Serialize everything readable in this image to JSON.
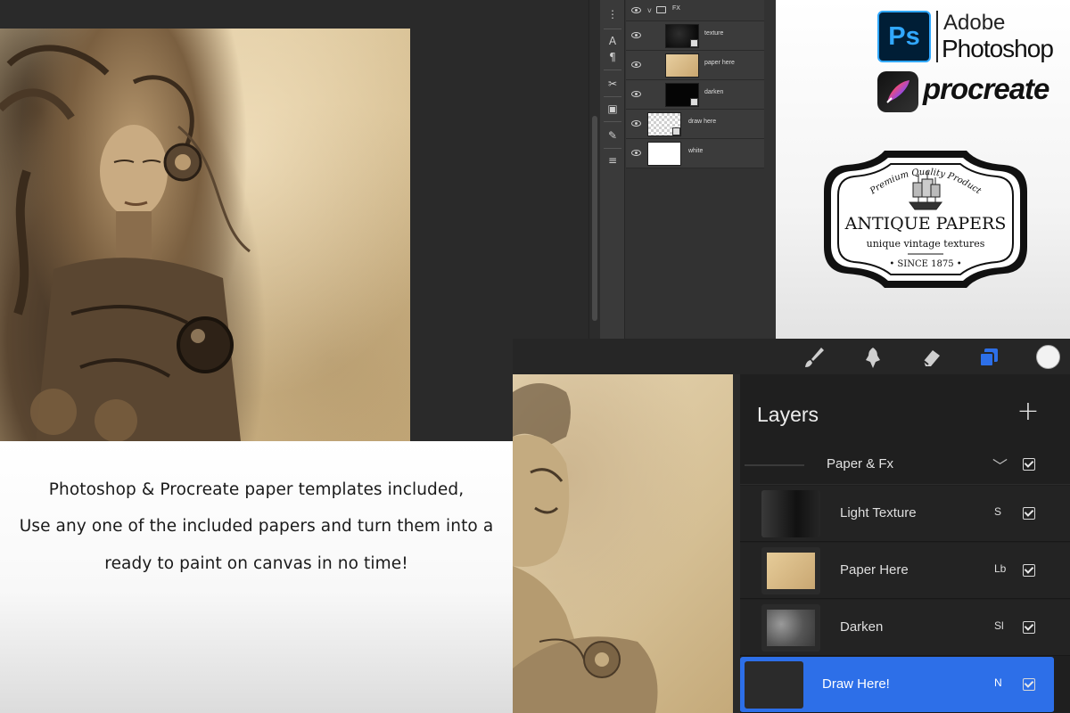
{
  "photoshop_panel": {
    "group": {
      "name": "FX"
    },
    "layers": [
      {
        "name": "texture",
        "thumb": "black-texture",
        "in_group": true
      },
      {
        "name": "paper here",
        "thumb": "paper",
        "in_group": true
      },
      {
        "name": "darken",
        "thumb": "black",
        "in_group": true
      },
      {
        "name": "draw here",
        "thumb": "sketch",
        "in_group": false
      },
      {
        "name": "white",
        "thumb": "white",
        "in_group": false
      }
    ]
  },
  "branding": {
    "photoshop_logo": {
      "letters": "Ps",
      "line1": "Adobe",
      "line2": "Photoshop"
    },
    "procreate_logo": {
      "word": "procreate"
    },
    "badge": {
      "top_arc": "Premium Quality Product",
      "title": "ANTIQUE PAPERS",
      "subtitle": "unique vintage textures",
      "bottom": "• SINCE 1875 •"
    }
  },
  "caption": {
    "lines": [
      "Photoshop & Procreate paper templates included,",
      "Use any one of the included papers and turn them into a",
      "ready to paint on canvas in no time!"
    ]
  },
  "procreate": {
    "toolbar": {
      "tools": [
        "brush-icon",
        "smudge-icon",
        "eraser-icon",
        "layers-icon"
      ],
      "active_tool": "layers-icon",
      "color": "#f2f2f2"
    },
    "layers_panel": {
      "title": "Layers",
      "add_label": "+",
      "group": {
        "name": "Paper & Fx",
        "expanded_glyph": "﹀"
      },
      "layers": [
        {
          "name": "Light Texture",
          "blend": "S",
          "visible": true
        },
        {
          "name": "Paper Here",
          "blend": "Lb",
          "visible": true
        },
        {
          "name": "Darken",
          "blend": "Sl",
          "visible": true
        },
        {
          "name": "Draw Here!",
          "blend": "N",
          "visible": true,
          "selected": true
        }
      ]
    }
  },
  "colors": {
    "procreate_accent": "#2d6fe8",
    "photoshop_blue": "#31a8ff",
    "photoshop_bg": "#001e36"
  }
}
